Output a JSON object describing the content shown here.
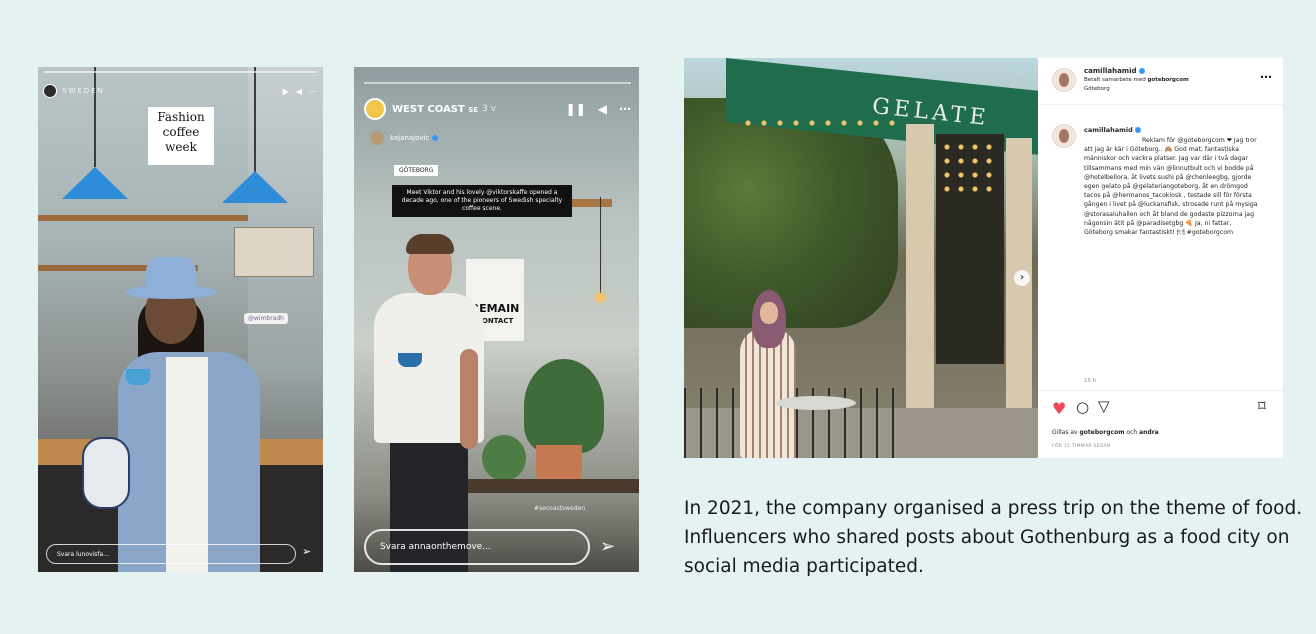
{
  "story1": {
    "username": "SWEDEN",
    "sticker_lines": [
      "Fashion",
      "coffee",
      "week"
    ],
    "tag": "@wimbradh",
    "reply_placeholder": "Svara lunovisfa...",
    "icons": {
      "play": "play-icon",
      "mute": "speaker-icon",
      "more": "more-icon",
      "send": "send-icon"
    }
  },
  "story2": {
    "username": "WEST COAST",
    "username_suffix": "SE",
    "time": "3 v",
    "mention": "kajanajovic",
    "place": "GÖTEBORG",
    "caption": "Meet Viktor and his lovely @viktorskaffe opened a decade ago, one of the pioneers of Swedish specialty coffee scene.",
    "poster_line1": "REMAIN",
    "poster_line2": "CONTACT",
    "hashtag": "#secoastsweden",
    "reply_placeholder": "Svara annaonthemove...",
    "icons": {
      "pause": "pause-icon",
      "mute": "speaker-icon",
      "more": "more-icon",
      "send": "send-icon"
    }
  },
  "post": {
    "awning_text": "GELATE",
    "header": {
      "username": "camillahamid",
      "paid_prefix": "Betalt samarbete med",
      "paid_partner": "goteborgcom",
      "location": "Göteborg"
    },
    "caption": {
      "username": "camillahamid",
      "text": "Reklam för @goteborgcom ❤ Jag tror att jag är kär i Göteborg.. 🙈 God mat, fantastiska människor och vackra platser. Jag var där i två dagar tillsammans med min vän @linnutbult och vi bodde på @hotelbellora, åt livets sushi på @chenleegbg, gjorde egen gelato på @gelateriangoteborg, åt en drömgod tacos på @hermanos_tacokiosk , testade sill för första gången i livet på @luckansfisk, strosade runt på mysiga @storasaluhallen och åt bland de godaste pizzorna jag någonsin ätit på @paradisetgbg 🍕 Ja, ni fattar, Göteborg smakar fantastiskt! 🍽 #goteborgcom",
      "time": "15 h"
    },
    "likes_prefix": "Gillas av",
    "likes_user": "goteborgcom",
    "likes_suffix": "och",
    "likes_others": "andra",
    "posted_ago": "FÖR 15 TIMMAR SEDAN",
    "icons": {
      "like": "heart-icon",
      "comment": "comment-icon",
      "share": "share-icon",
      "save": "bookmark-icon",
      "next": "chevron-right-icon"
    },
    "colors": {
      "like": "#ed4956",
      "verified": "#3897f0"
    }
  },
  "description": "In 2021, the company organised a press trip on the theme of food. Influencers who shared posts about Gothenburg as a food city on social media participated."
}
